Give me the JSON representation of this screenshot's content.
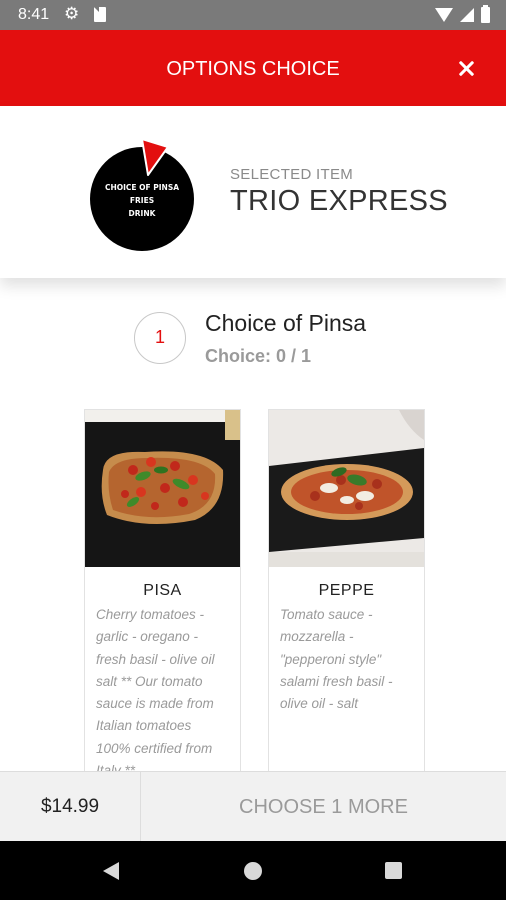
{
  "status_bar": {
    "time": "8:41"
  },
  "header": {
    "title": "OPTIONS CHOICE"
  },
  "selected": {
    "label": "SELECTED ITEM",
    "name": "TRIO EXPRESS",
    "logo_lines": [
      "CHOICE OF PINSA",
      "FRIES",
      "DRINK"
    ]
  },
  "section": {
    "number": "1",
    "title": "Choice of Pinsa",
    "choice": "Choice: 0 / 1"
  },
  "products": [
    {
      "name": "PISA",
      "description_lines": [
        "Cherry tomatoes -",
        "garlic - oregano -",
        "fresh basil - olive oil",
        "salt ** Our tomato",
        "sauce is made from",
        "Italian tomatoes",
        "100% certified from",
        "Italy **"
      ]
    },
    {
      "name": "PEPPE",
      "description_lines": [
        "Tomato sauce -",
        "mozzarella -",
        "\"pepperoni style\"",
        "salami fresh basil -",
        "olive oil - salt"
      ]
    }
  ],
  "footer": {
    "price": "$14.99",
    "button_label": "CHOOSE 1 MORE"
  },
  "colors": {
    "accent": "#e30f0f",
    "status_bar": "#7a7a7a",
    "footer_bg": "#f1f1f1",
    "muted_text": "#9a9a9a"
  }
}
